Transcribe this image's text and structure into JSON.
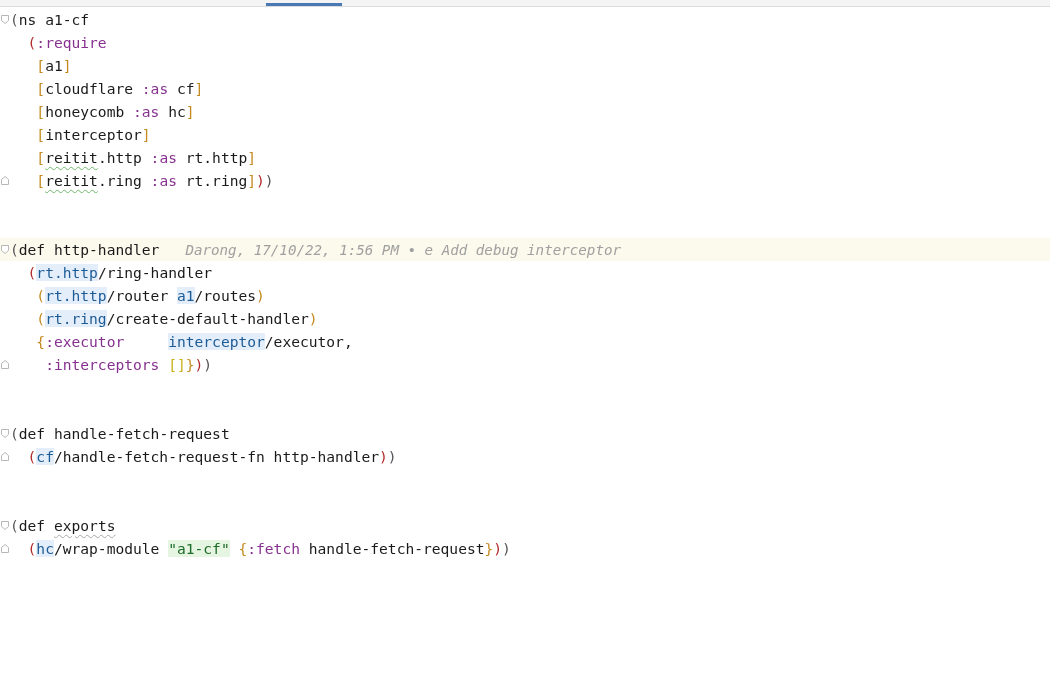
{
  "lines": [
    {
      "fold_start": true,
      "fold_end": false,
      "current": false,
      "tokens": [
        {
          "text": "(",
          "kind": "paren1"
        },
        {
          "text": "ns a1-cf",
          "kind": "plain"
        }
      ]
    },
    {
      "fold_start": false,
      "fold_end": false,
      "current": false,
      "tokens": [
        {
          "text": "  (",
          "kind": "paren2"
        },
        {
          "text": ":require",
          "kind": "keyword"
        }
      ]
    },
    {
      "fold_start": false,
      "fold_end": false,
      "current": false,
      "tokens": [
        {
          "text": "   [",
          "kind": "paren3"
        },
        {
          "text": "a1",
          "kind": "plain"
        },
        {
          "text": "]",
          "kind": "paren3"
        }
      ]
    },
    {
      "fold_start": false,
      "fold_end": false,
      "current": false,
      "tokens": [
        {
          "text": "   [",
          "kind": "paren3"
        },
        {
          "text": "cloudflare ",
          "kind": "plain"
        },
        {
          "text": ":as",
          "kind": "keyword"
        },
        {
          "text": " cf",
          "kind": "plain"
        },
        {
          "text": "]",
          "kind": "paren3"
        }
      ]
    },
    {
      "fold_start": false,
      "fold_end": false,
      "current": false,
      "tokens": [
        {
          "text": "   [",
          "kind": "paren3"
        },
        {
          "text": "honeycomb ",
          "kind": "plain"
        },
        {
          "text": ":as",
          "kind": "keyword"
        },
        {
          "text": " hc",
          "kind": "plain"
        },
        {
          "text": "]",
          "kind": "paren3"
        }
      ]
    },
    {
      "fold_start": false,
      "fold_end": false,
      "current": false,
      "tokens": [
        {
          "text": "   [",
          "kind": "paren3"
        },
        {
          "text": "interceptor",
          "kind": "plain"
        },
        {
          "text": "]",
          "kind": "paren3"
        }
      ]
    },
    {
      "fold_start": false,
      "fold_end": false,
      "current": false,
      "tokens": [
        {
          "text": "   [",
          "kind": "paren3"
        },
        {
          "text": "reitit",
          "kind": "typo"
        },
        {
          "text": ".http ",
          "kind": "plain"
        },
        {
          "text": ":as",
          "kind": "keyword"
        },
        {
          "text": " rt.http",
          "kind": "plain"
        },
        {
          "text": "]",
          "kind": "paren3"
        }
      ]
    },
    {
      "fold_start": false,
      "fold_end": true,
      "current": false,
      "tokens": [
        {
          "text": "   [",
          "kind": "paren3"
        },
        {
          "text": "reitit",
          "kind": "typo"
        },
        {
          "text": ".ring ",
          "kind": "plain"
        },
        {
          "text": ":as",
          "kind": "keyword"
        },
        {
          "text": " rt.ring",
          "kind": "plain"
        },
        {
          "text": "]",
          "kind": "paren3"
        },
        {
          "text": ")",
          "kind": "paren2"
        },
        {
          "text": ")",
          "kind": "paren1"
        }
      ]
    },
    {
      "fold_start": false,
      "fold_end": false,
      "current": false
    },
    {
      "fold_start": false,
      "fold_end": false,
      "current": false
    },
    {
      "fold_start": true,
      "fold_end": false,
      "current": true,
      "blame": "Darong, 17/10/22, 1:56 PM • e Add debug interceptor",
      "tokens": [
        {
          "text": "(",
          "kind": "paren1"
        },
        {
          "text": "def http-handler",
          "kind": "plain"
        }
      ]
    },
    {
      "fold_start": false,
      "fold_end": false,
      "current": false,
      "tokens": [
        {
          "text": "  (",
          "kind": "paren2"
        },
        {
          "text": "rt.http",
          "kind": "ns"
        },
        {
          "text": "/ring-handler",
          "kind": "plain"
        }
      ]
    },
    {
      "fold_start": false,
      "fold_end": false,
      "current": false,
      "tokens": [
        {
          "text": "   (",
          "kind": "paren3"
        },
        {
          "text": "rt.http",
          "kind": "ns"
        },
        {
          "text": "/router ",
          "kind": "plain"
        },
        {
          "text": "a1",
          "kind": "ns"
        },
        {
          "text": "/routes",
          "kind": "plain"
        },
        {
          "text": ")",
          "kind": "paren3"
        }
      ]
    },
    {
      "fold_start": false,
      "fold_end": false,
      "current": false,
      "tokens": [
        {
          "text": "   (",
          "kind": "paren3"
        },
        {
          "text": "rt.ring",
          "kind": "ns"
        },
        {
          "text": "/create-default-handler",
          "kind": "plain"
        },
        {
          "text": ")",
          "kind": "paren3"
        }
      ]
    },
    {
      "fold_start": false,
      "fold_end": false,
      "current": false,
      "tokens": [
        {
          "text": "   {",
          "kind": "paren3"
        },
        {
          "text": ":executor     ",
          "kind": "keyword"
        },
        {
          "text": "interceptor",
          "kind": "ns"
        },
        {
          "text": "/executor,",
          "kind": "plain"
        }
      ]
    },
    {
      "fold_start": false,
      "fold_end": true,
      "current": false,
      "tokens": [
        {
          "text": "    :interceptors ",
          "kind": "keyword"
        },
        {
          "text": "[]",
          "kind": "paren4"
        },
        {
          "text": "}",
          "kind": "paren3"
        },
        {
          "text": ")",
          "kind": "paren2"
        },
        {
          "text": ")",
          "kind": "paren1"
        }
      ]
    },
    {
      "fold_start": false,
      "fold_end": false,
      "current": false
    },
    {
      "fold_start": false,
      "fold_end": false,
      "current": false
    },
    {
      "fold_start": true,
      "fold_end": false,
      "current": false,
      "tokens": [
        {
          "text": "(",
          "kind": "paren1"
        },
        {
          "text": "def handle-fetch-request",
          "kind": "plain"
        }
      ]
    },
    {
      "fold_start": false,
      "fold_end": true,
      "current": false,
      "tokens": [
        {
          "text": "  (",
          "kind": "paren2"
        },
        {
          "text": "cf",
          "kind": "ns"
        },
        {
          "text": "/handle-fetch-request-fn http-handler",
          "kind": "plain"
        },
        {
          "text": ")",
          "kind": "paren2"
        },
        {
          "text": ")",
          "kind": "paren1"
        }
      ]
    },
    {
      "fold_start": false,
      "fold_end": false,
      "current": false
    },
    {
      "fold_start": false,
      "fold_end": false,
      "current": false
    },
    {
      "fold_start": true,
      "fold_end": false,
      "current": false,
      "tokens": [
        {
          "text": "(",
          "kind": "paren1"
        },
        {
          "text": "def ",
          "kind": "plain"
        },
        {
          "text": "exports",
          "kind": "unused"
        }
      ]
    },
    {
      "fold_start": false,
      "fold_end": true,
      "current": false,
      "tokens": [
        {
          "text": "  (",
          "kind": "paren2"
        },
        {
          "text": "hc",
          "kind": "ns"
        },
        {
          "text": "/wrap-module ",
          "kind": "plain"
        },
        {
          "text": "\"a1-cf\"",
          "kind": "string"
        },
        {
          "text": " {",
          "kind": "paren3"
        },
        {
          "text": ":fetch",
          "kind": "keyword"
        },
        {
          "text": " handle-fetch-request",
          "kind": "plain"
        },
        {
          "text": "}",
          "kind": "paren3"
        },
        {
          "text": ")",
          "kind": "paren2"
        },
        {
          "text": ")",
          "kind": "paren1"
        }
      ]
    }
  ]
}
